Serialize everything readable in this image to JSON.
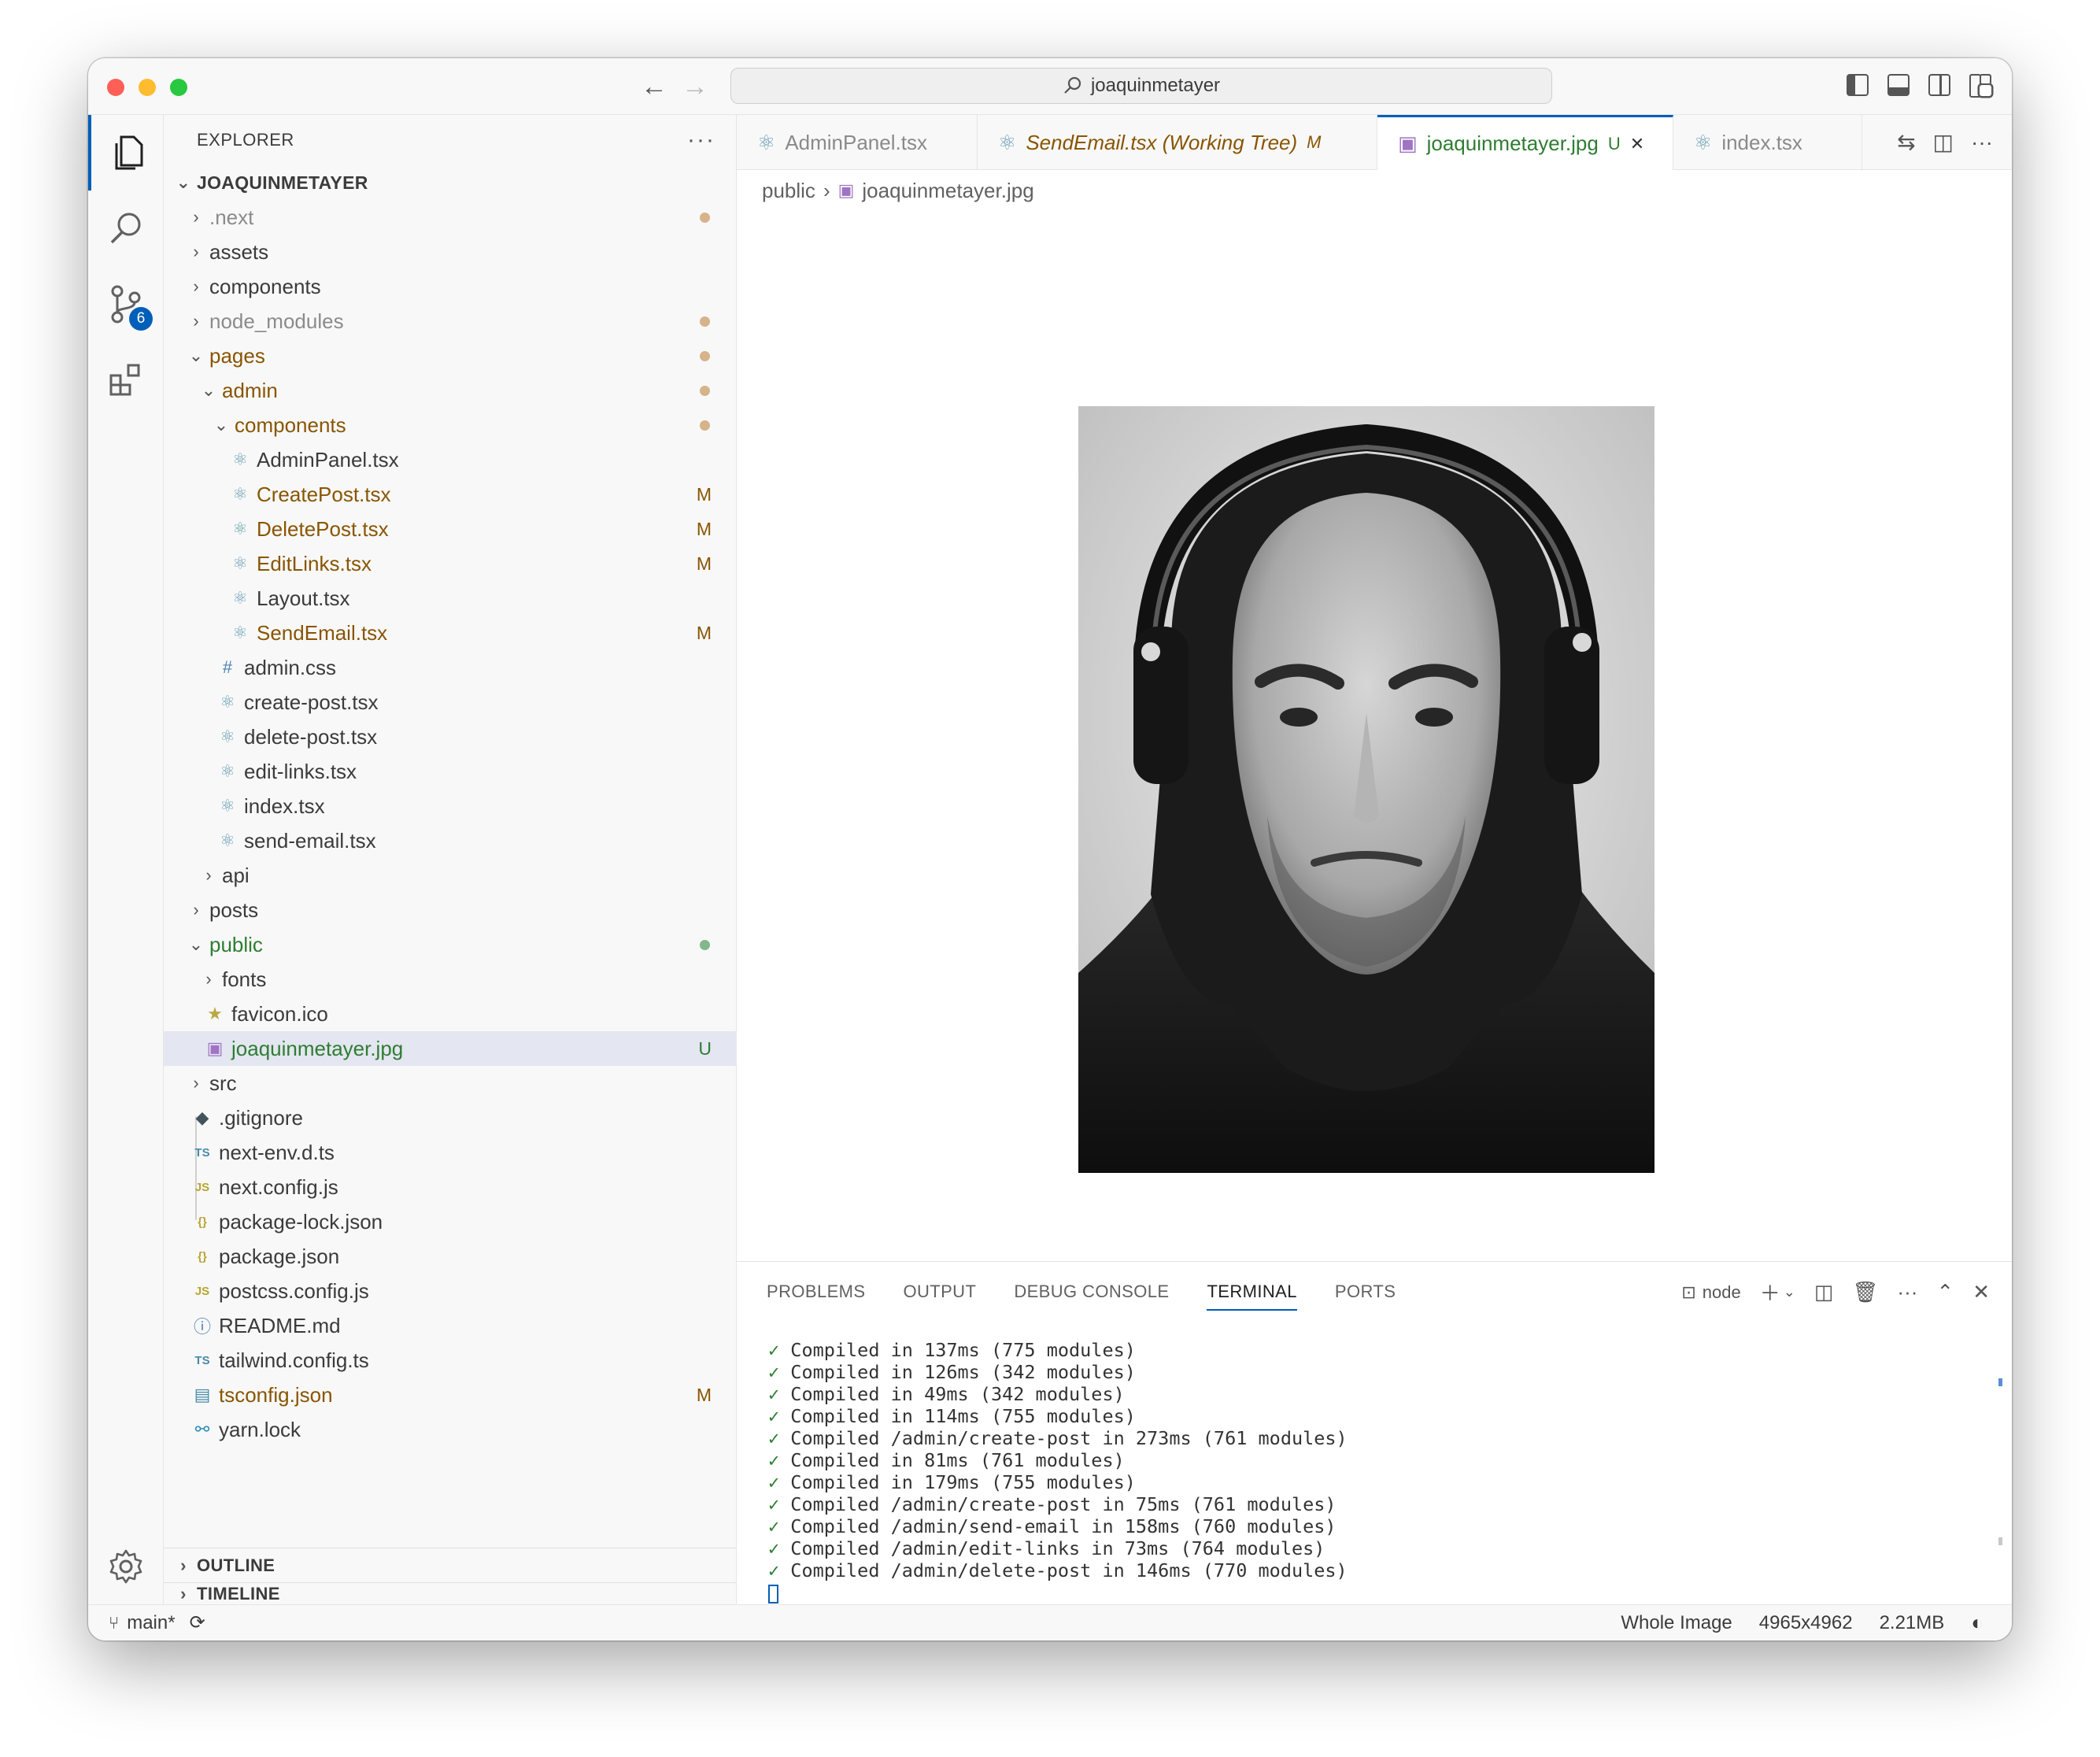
{
  "window": {
    "search_text": "joaquinmetayer"
  },
  "activity": {
    "scm_badge": "6"
  },
  "explorer": {
    "title": "EXPLORER",
    "more": "···",
    "root": "JOAQUINMETAYER",
    "items": [
      {
        "label": ".next",
        "kind": "folder",
        "state": "ignored"
      },
      {
        "label": "assets",
        "kind": "folder"
      },
      {
        "label": "components",
        "kind": "folder"
      },
      {
        "label": "node_modules",
        "kind": "folder",
        "state": "ignored"
      },
      {
        "label": "pages",
        "kind": "folder-open",
        "state": "modified"
      },
      {
        "label": "admin",
        "kind": "folder-open",
        "state": "modified"
      },
      {
        "label": "components",
        "kind": "folder-open",
        "state": "modified"
      },
      {
        "label": "AdminPanel.tsx",
        "kind": "react"
      },
      {
        "label": "CreatePost.tsx",
        "kind": "react",
        "state": "modified",
        "decoration": "M"
      },
      {
        "label": "DeletePost.tsx",
        "kind": "react",
        "state": "modified",
        "decoration": "M"
      },
      {
        "label": "EditLinks.tsx",
        "kind": "react",
        "state": "modified",
        "decoration": "M"
      },
      {
        "label": "Layout.tsx",
        "kind": "react"
      },
      {
        "label": "SendEmail.tsx",
        "kind": "react",
        "state": "modified",
        "decoration": "M"
      },
      {
        "label": "admin.css",
        "kind": "css"
      },
      {
        "label": "create-post.tsx",
        "kind": "react"
      },
      {
        "label": "delete-post.tsx",
        "kind": "react"
      },
      {
        "label": "edit-links.tsx",
        "kind": "react"
      },
      {
        "label": "index.tsx",
        "kind": "react"
      },
      {
        "label": "send-email.tsx",
        "kind": "react"
      },
      {
        "label": "api",
        "kind": "folder"
      },
      {
        "label": "posts",
        "kind": "folder"
      },
      {
        "label": "public",
        "kind": "folder-open",
        "state": "untracked"
      },
      {
        "label": "fonts",
        "kind": "folder"
      },
      {
        "label": "favicon.ico",
        "kind": "star"
      },
      {
        "label": "joaquinmetayer.jpg",
        "kind": "image",
        "state": "untracked",
        "decoration": "U"
      },
      {
        "label": "src",
        "kind": "folder"
      },
      {
        "label": ".gitignore",
        "kind": "git"
      },
      {
        "label": "next-env.d.ts",
        "kind": "ts"
      },
      {
        "label": "next.config.js",
        "kind": "js"
      },
      {
        "label": "package-lock.json",
        "kind": "json"
      },
      {
        "label": "package.json",
        "kind": "json"
      },
      {
        "label": "postcss.config.js",
        "kind": "js"
      },
      {
        "label": "README.md",
        "kind": "info"
      },
      {
        "label": "tailwind.config.ts",
        "kind": "ts"
      },
      {
        "label": "tsconfig.json",
        "kind": "tsconfig",
        "state": "modified",
        "decoration": "M"
      },
      {
        "label": "yarn.lock",
        "kind": "yarn"
      }
    ],
    "outline": "OUTLINE",
    "timeline": "TIMELINE"
  },
  "tabs": [
    {
      "label": "AdminPanel.tsx"
    },
    {
      "label": "SendEmail.tsx (Working Tree)",
      "decoration": "M"
    },
    {
      "label": "joaquinmetayer.jpg",
      "decoration": "U",
      "close": "✕"
    },
    {
      "label": "index.tsx"
    }
  ],
  "breadcrumb": {
    "folder": "public",
    "file": "joaquinmetayer.jpg"
  },
  "panel": {
    "tabs": [
      "PROBLEMS",
      "OUTPUT",
      "DEBUG CONSOLE",
      "TERMINAL",
      "PORTS"
    ],
    "terminal_name": "node",
    "lines": [
      "Compiled in 137ms (775 modules)",
      "Compiled in 126ms (342 modules)",
      "Compiled in 49ms (342 modules)",
      "Compiled in 114ms (755 modules)",
      "Compiled /admin/create-post in 273ms (761 modules)",
      "Compiled in 81ms (761 modules)",
      "Compiled in 179ms (755 modules)",
      "Compiled /admin/create-post in 75ms (761 modules)",
      "Compiled /admin/send-email in 158ms (760 modules)",
      "Compiled /admin/edit-links in 73ms (764 modules)",
      "Compiled /admin/delete-post in 146ms (770 modules)"
    ]
  },
  "status": {
    "branch": "main*",
    "view": "Whole Image",
    "dimensions": "4965x4962",
    "size": "2.21MB"
  },
  "colors": {
    "accent": "#005fb8",
    "modified": "#895503",
    "untracked": "#2e7d32"
  }
}
